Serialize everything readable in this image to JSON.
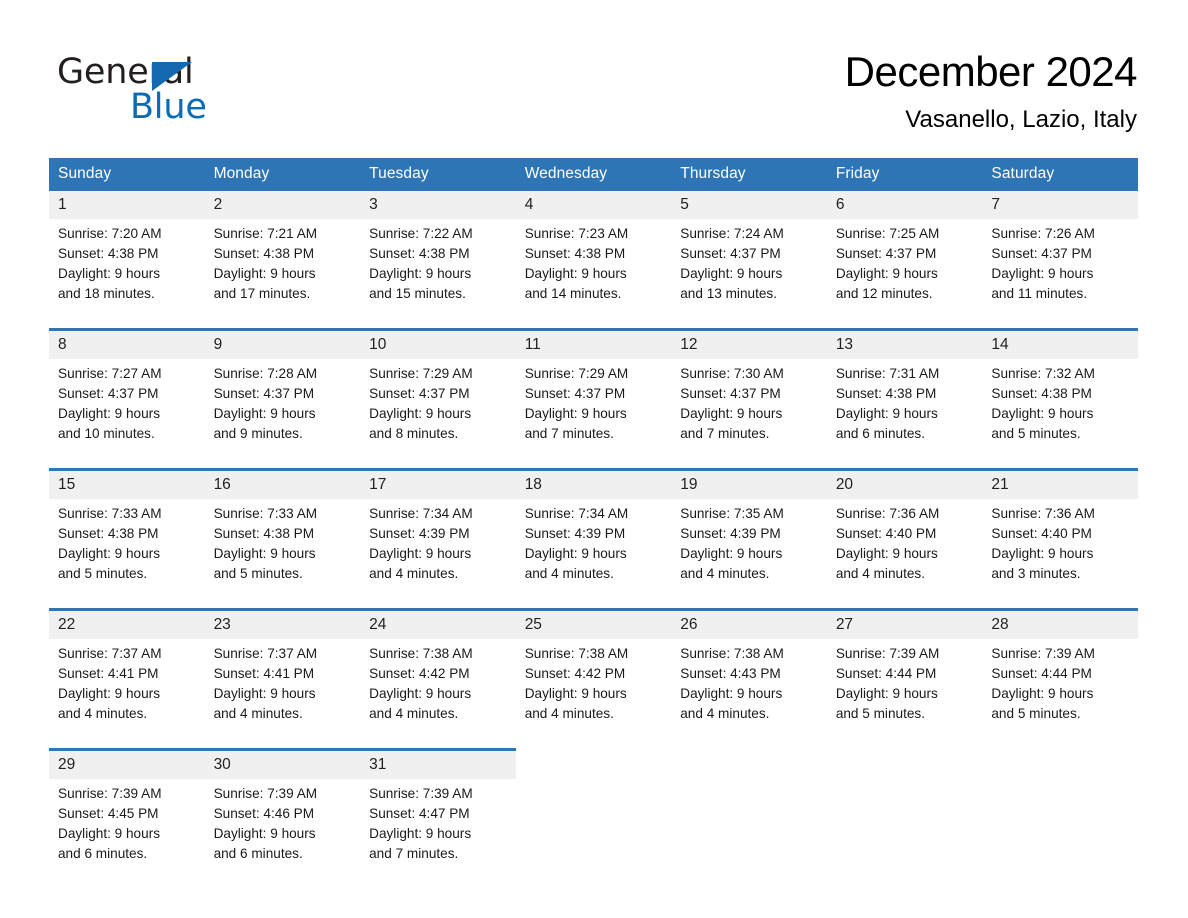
{
  "brand": {
    "name_part1": "General",
    "name_part2": "Blue",
    "flag_color": "#1569b0",
    "blue_text_color": "#0a6cb4"
  },
  "header": {
    "month_title": "December 2024",
    "location": "Vasanello, Lazio, Italy"
  },
  "theme": {
    "header_bg": "#2e75b6",
    "header_text": "#ffffff",
    "daynum_bg": "#f0f0f0",
    "cell_bg": "#ffffff",
    "separator": "#2e75b6"
  },
  "weekday_headers": [
    "Sunday",
    "Monday",
    "Tuesday",
    "Wednesday",
    "Thursday",
    "Friday",
    "Saturday"
  ],
  "days": [
    {
      "date": "1",
      "sunrise": "Sunrise: 7:20 AM",
      "sunset": "Sunset: 4:38 PM",
      "daylight_1": "Daylight: 9 hours",
      "daylight_2": "and 18 minutes."
    },
    {
      "date": "2",
      "sunrise": "Sunrise: 7:21 AM",
      "sunset": "Sunset: 4:38 PM",
      "daylight_1": "Daylight: 9 hours",
      "daylight_2": "and 17 minutes."
    },
    {
      "date": "3",
      "sunrise": "Sunrise: 7:22 AM",
      "sunset": "Sunset: 4:38 PM",
      "daylight_1": "Daylight: 9 hours",
      "daylight_2": "and 15 minutes."
    },
    {
      "date": "4",
      "sunrise": "Sunrise: 7:23 AM",
      "sunset": "Sunset: 4:38 PM",
      "daylight_1": "Daylight: 9 hours",
      "daylight_2": "and 14 minutes."
    },
    {
      "date": "5",
      "sunrise": "Sunrise: 7:24 AM",
      "sunset": "Sunset: 4:37 PM",
      "daylight_1": "Daylight: 9 hours",
      "daylight_2": "and 13 minutes."
    },
    {
      "date": "6",
      "sunrise": "Sunrise: 7:25 AM",
      "sunset": "Sunset: 4:37 PM",
      "daylight_1": "Daylight: 9 hours",
      "daylight_2": "and 12 minutes."
    },
    {
      "date": "7",
      "sunrise": "Sunrise: 7:26 AM",
      "sunset": "Sunset: 4:37 PM",
      "daylight_1": "Daylight: 9 hours",
      "daylight_2": "and 11 minutes."
    },
    {
      "date": "8",
      "sunrise": "Sunrise: 7:27 AM",
      "sunset": "Sunset: 4:37 PM",
      "daylight_1": "Daylight: 9 hours",
      "daylight_2": "and 10 minutes."
    },
    {
      "date": "9",
      "sunrise": "Sunrise: 7:28 AM",
      "sunset": "Sunset: 4:37 PM",
      "daylight_1": "Daylight: 9 hours",
      "daylight_2": "and 9 minutes."
    },
    {
      "date": "10",
      "sunrise": "Sunrise: 7:29 AM",
      "sunset": "Sunset: 4:37 PM",
      "daylight_1": "Daylight: 9 hours",
      "daylight_2": "and 8 minutes."
    },
    {
      "date": "11",
      "sunrise": "Sunrise: 7:29 AM",
      "sunset": "Sunset: 4:37 PM",
      "daylight_1": "Daylight: 9 hours",
      "daylight_2": "and 7 minutes."
    },
    {
      "date": "12",
      "sunrise": "Sunrise: 7:30 AM",
      "sunset": "Sunset: 4:37 PM",
      "daylight_1": "Daylight: 9 hours",
      "daylight_2": "and 7 minutes."
    },
    {
      "date": "13",
      "sunrise": "Sunrise: 7:31 AM",
      "sunset": "Sunset: 4:38 PM",
      "daylight_1": "Daylight: 9 hours",
      "daylight_2": "and 6 minutes."
    },
    {
      "date": "14",
      "sunrise": "Sunrise: 7:32 AM",
      "sunset": "Sunset: 4:38 PM",
      "daylight_1": "Daylight: 9 hours",
      "daylight_2": "and 5 minutes."
    },
    {
      "date": "15",
      "sunrise": "Sunrise: 7:33 AM",
      "sunset": "Sunset: 4:38 PM",
      "daylight_1": "Daylight: 9 hours",
      "daylight_2": "and 5 minutes."
    },
    {
      "date": "16",
      "sunrise": "Sunrise: 7:33 AM",
      "sunset": "Sunset: 4:38 PM",
      "daylight_1": "Daylight: 9 hours",
      "daylight_2": "and 5 minutes."
    },
    {
      "date": "17",
      "sunrise": "Sunrise: 7:34 AM",
      "sunset": "Sunset: 4:39 PM",
      "daylight_1": "Daylight: 9 hours",
      "daylight_2": "and 4 minutes."
    },
    {
      "date": "18",
      "sunrise": "Sunrise: 7:34 AM",
      "sunset": "Sunset: 4:39 PM",
      "daylight_1": "Daylight: 9 hours",
      "daylight_2": "and 4 minutes."
    },
    {
      "date": "19",
      "sunrise": "Sunrise: 7:35 AM",
      "sunset": "Sunset: 4:39 PM",
      "daylight_1": "Daylight: 9 hours",
      "daylight_2": "and 4 minutes."
    },
    {
      "date": "20",
      "sunrise": "Sunrise: 7:36 AM",
      "sunset": "Sunset: 4:40 PM",
      "daylight_1": "Daylight: 9 hours",
      "daylight_2": "and 4 minutes."
    },
    {
      "date": "21",
      "sunrise": "Sunrise: 7:36 AM",
      "sunset": "Sunset: 4:40 PM",
      "daylight_1": "Daylight: 9 hours",
      "daylight_2": "and 3 minutes."
    },
    {
      "date": "22",
      "sunrise": "Sunrise: 7:37 AM",
      "sunset": "Sunset: 4:41 PM",
      "daylight_1": "Daylight: 9 hours",
      "daylight_2": "and 4 minutes."
    },
    {
      "date": "23",
      "sunrise": "Sunrise: 7:37 AM",
      "sunset": "Sunset: 4:41 PM",
      "daylight_1": "Daylight: 9 hours",
      "daylight_2": "and 4 minutes."
    },
    {
      "date": "24",
      "sunrise": "Sunrise: 7:38 AM",
      "sunset": "Sunset: 4:42 PM",
      "daylight_1": "Daylight: 9 hours",
      "daylight_2": "and 4 minutes."
    },
    {
      "date": "25",
      "sunrise": "Sunrise: 7:38 AM",
      "sunset": "Sunset: 4:42 PM",
      "daylight_1": "Daylight: 9 hours",
      "daylight_2": "and 4 minutes."
    },
    {
      "date": "26",
      "sunrise": "Sunrise: 7:38 AM",
      "sunset": "Sunset: 4:43 PM",
      "daylight_1": "Daylight: 9 hours",
      "daylight_2": "and 4 minutes."
    },
    {
      "date": "27",
      "sunrise": "Sunrise: 7:39 AM",
      "sunset": "Sunset: 4:44 PM",
      "daylight_1": "Daylight: 9 hours",
      "daylight_2": "and 5 minutes."
    },
    {
      "date": "28",
      "sunrise": "Sunrise: 7:39 AM",
      "sunset": "Sunset: 4:44 PM",
      "daylight_1": "Daylight: 9 hours",
      "daylight_2": "and 5 minutes."
    },
    {
      "date": "29",
      "sunrise": "Sunrise: 7:39 AM",
      "sunset": "Sunset: 4:45 PM",
      "daylight_1": "Daylight: 9 hours",
      "daylight_2": "and 6 minutes."
    },
    {
      "date": "30",
      "sunrise": "Sunrise: 7:39 AM",
      "sunset": "Sunset: 4:46 PM",
      "daylight_1": "Daylight: 9 hours",
      "daylight_2": "and 6 minutes."
    },
    {
      "date": "31",
      "sunrise": "Sunrise: 7:39 AM",
      "sunset": "Sunset: 4:47 PM",
      "daylight_1": "Daylight: 9 hours",
      "daylight_2": "and 7 minutes."
    }
  ],
  "grid": {
    "first_day_column_index": 0,
    "weeks": 5
  }
}
